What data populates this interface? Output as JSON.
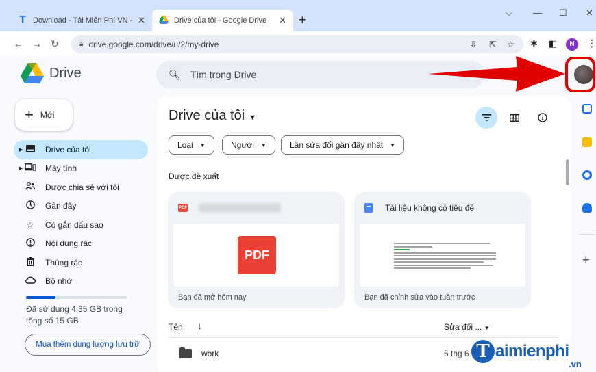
{
  "browser": {
    "tabs": [
      {
        "title": "Download - Tải Miễn Phí VN - Ph",
        "favicon": "T"
      },
      {
        "title": "Drive của tôi - Google Drive"
      }
    ],
    "window_controls": [
      "⌵",
      "—",
      "☐",
      "✕"
    ],
    "url": "drive.google.com/drive/u/2/my-drive",
    "profile_initial": "N"
  },
  "drive": {
    "app_name": "Drive",
    "search_placeholder": "Tìm trong Drive",
    "new_label": "Mới",
    "nav": [
      {
        "label": "Drive của tôi",
        "icon": "my-drive-icon",
        "active": true
      },
      {
        "label": "Máy tính",
        "icon": "computer-icon"
      },
      {
        "label": "Được chia sẻ với tôi",
        "icon": "shared-icon"
      },
      {
        "label": "Gần đây",
        "icon": "clock-icon"
      },
      {
        "label": "Có gắn dấu sao",
        "icon": "star-icon"
      },
      {
        "label": "Nội dung rác",
        "icon": "spam-icon"
      },
      {
        "label": "Thùng rác",
        "icon": "trash-icon"
      },
      {
        "label": "Bộ nhớ",
        "icon": "cloud-icon"
      }
    ],
    "storage": {
      "used_text": "Đã sử dụng 4,35 GB trong",
      "total_text": "tổng số 15 GB",
      "used_fraction": 0.29
    },
    "buy_storage": "Mua thêm dung lượng lưu trữ",
    "main": {
      "title": "Drive của tôi",
      "filters": [
        "Loại",
        "Người",
        "Lần sửa đổi gần đây nhất"
      ],
      "suggested_label": "Được đề xuất",
      "cards": [
        {
          "title": "",
          "thumb": "PDF",
          "footer": "Bạn đã mở hôm nay"
        },
        {
          "title": "Tài liệu không có tiêu đề",
          "footer": "Bạn đã chỉnh sửa vào tuần trước"
        }
      ],
      "columns": {
        "name": "Tên",
        "modified": "Sửa đổi ..."
      },
      "rows": [
        {
          "name": "work",
          "modified": "6 thg 6"
        }
      ]
    }
  },
  "watermark": {
    "letter": "T",
    "text": "aimienphi",
    "suffix": ".vn"
  },
  "colors": {
    "arrow": "#e00000",
    "active_nav": "#c2e7ff",
    "accent": "#0b57d0"
  }
}
